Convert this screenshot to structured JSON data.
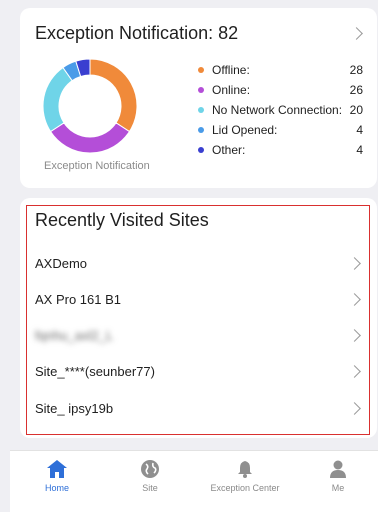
{
  "exception_card": {
    "title": "Exception Notification: 82",
    "donut_caption": "Exception Notification",
    "items": [
      {
        "label": "Offline:",
        "value": "28",
        "color": "#f08a3a"
      },
      {
        "label": "Online:",
        "value": "26",
        "color": "#b44ed8"
      },
      {
        "label": "No Network Connection:",
        "value": "20",
        "color": "#6fd4e8"
      },
      {
        "label": "Lid Opened:",
        "value": "4",
        "color": "#4a9be8"
      },
      {
        "label": "Other:",
        "value": "4",
        "color": "#3a3fd0"
      }
    ]
  },
  "recent_sites": {
    "title": "Recently Visited Sites",
    "sites": [
      "AXDemo",
      "AX Pro 161 B1",
      "fqnhu_axl2_L",
      "Site_****(seunber77)",
      "Site_ ipsy19b"
    ]
  },
  "tabbar": {
    "tabs": [
      {
        "label": "Home",
        "icon": "home-icon",
        "active": true
      },
      {
        "label": "Site",
        "icon": "globe-icon",
        "active": false
      },
      {
        "label": "Exception Center",
        "icon": "bell-icon",
        "active": false
      },
      {
        "label": "Me",
        "icon": "person-icon",
        "active": false
      }
    ]
  },
  "colors": {
    "accent": "#2e6fd8",
    "highlight_border": "#d9302f"
  }
}
